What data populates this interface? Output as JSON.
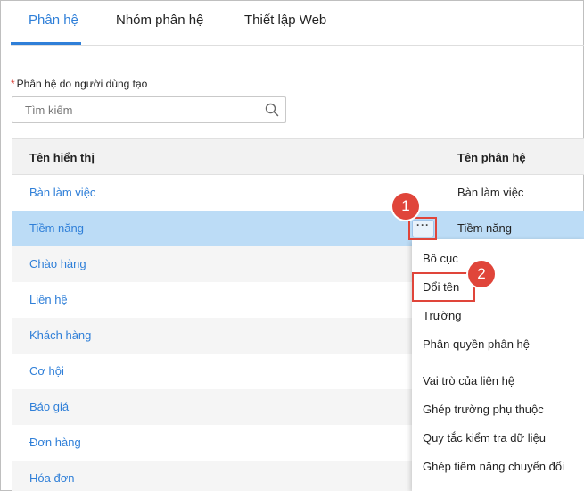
{
  "tabs": [
    {
      "label": "Phân hệ",
      "active": true
    },
    {
      "label": "Nhóm phân hệ",
      "active": false
    },
    {
      "label": "Thiết lập Web",
      "active": false
    }
  ],
  "section": {
    "required_mark": "*",
    "label": "Phân hệ do người dùng tạo"
  },
  "search": {
    "placeholder": "Tìm kiếm",
    "value": ""
  },
  "table": {
    "headers": [
      "Tên hiển thị",
      "Tên phân hệ"
    ],
    "rows": [
      {
        "display": "Bàn làm việc",
        "module": "Bàn làm việc"
      },
      {
        "display": "Tiềm năng",
        "module": "Tiềm năng"
      },
      {
        "display": "Chào hàng",
        "module": ""
      },
      {
        "display": "Liên hệ",
        "module": ""
      },
      {
        "display": "Khách hàng",
        "module": ""
      },
      {
        "display": "Cơ hội",
        "module": ""
      },
      {
        "display": "Báo giá",
        "module": ""
      },
      {
        "display": "Đơn hàng",
        "module": ""
      },
      {
        "display": "Hóa đơn",
        "module": ""
      }
    ],
    "selected_row_index": 1,
    "more_button_glyph": "···"
  },
  "context_menu": {
    "items": [
      "Bố cục",
      "Đổi tên",
      "Trường",
      "Phân quyền phân hệ",
      "Vai trò của liên hệ",
      "Ghép trường phụ thuộc",
      "Quy tắc kiểm tra dữ liệu",
      "Ghép tiềm năng chuyển đổi"
    ]
  },
  "steps": [
    "1",
    "2"
  ],
  "colors": {
    "accent": "#2f7fd8",
    "selected_row": "#bcdcf6",
    "marker": "#e0453a"
  }
}
